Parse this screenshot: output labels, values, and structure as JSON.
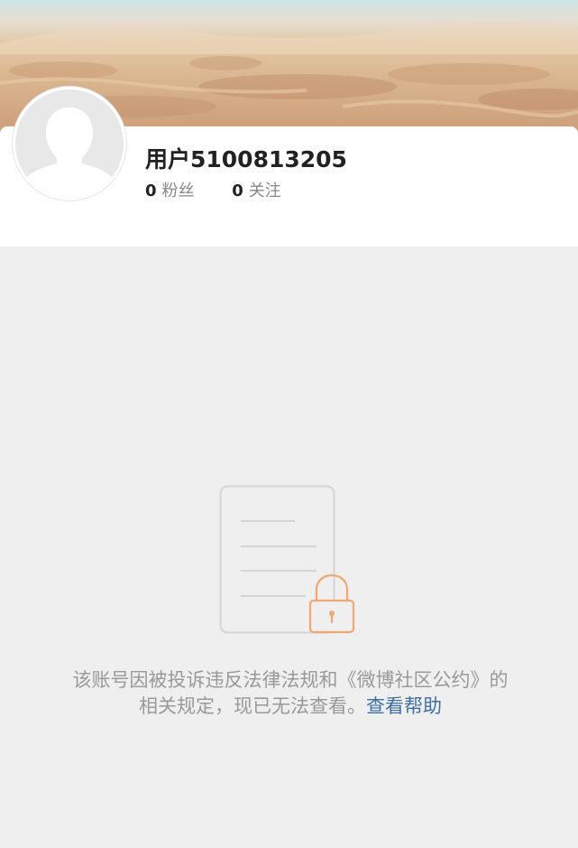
{
  "profile": {
    "username": "用户5100813205",
    "followers": {
      "count": "0",
      "label": "粉丝"
    },
    "following": {
      "count": "0",
      "label": "关注"
    }
  },
  "notice": {
    "message": "该账号因被投诉违反法律法规和《微博社区公约》的相关规定，现已无法查看。",
    "help_link": "查看帮助"
  },
  "icons": {
    "avatar": "default-avatar-icon",
    "locked_document": "locked-document-icon"
  },
  "colors": {
    "background": "#efefef",
    "link": "#3d6ea4",
    "lock": "#f1a76f",
    "text_muted": "#999999"
  }
}
